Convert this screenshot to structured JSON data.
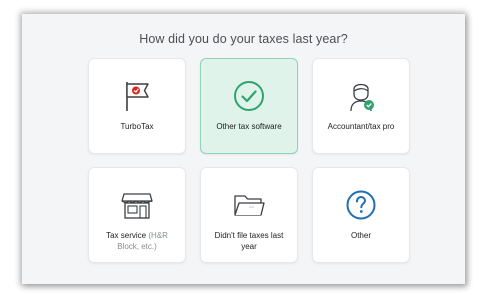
{
  "question": "How did you do your taxes last year?",
  "options": [
    {
      "label": "TurboTax",
      "icon": "turbotax-logo-icon",
      "selected": false
    },
    {
      "label": "Other tax software",
      "icon": "checkmark-circle-icon",
      "selected": true
    },
    {
      "label": "Accountant/tax pro",
      "icon": "accountant-person-icon",
      "selected": false
    },
    {
      "label": "Tax service",
      "label_note": " (H&R Block, etc.)",
      "icon": "storefront-icon",
      "selected": false
    },
    {
      "label": "Didn't file taxes last year",
      "icon": "empty-folder-icon",
      "selected": false
    },
    {
      "label": "Other",
      "icon": "question-circle-icon",
      "selected": false
    }
  ],
  "colors": {
    "accent_green": "#2fa36e",
    "selected_bg": "#dff3ea",
    "turbotax_red": "#d52b1e",
    "help_blue": "#1f6fb5"
  }
}
